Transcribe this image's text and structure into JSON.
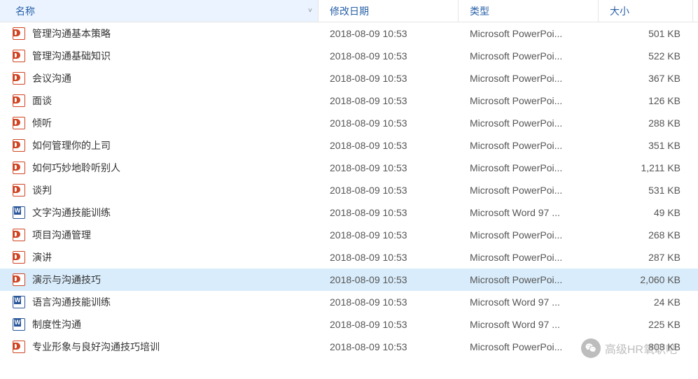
{
  "columns": {
    "name": "名称",
    "date": "修改日期",
    "type": "类型",
    "size": "大小"
  },
  "files": [
    {
      "name": "管理沟通基本策略",
      "date": "2018-08-09 10:53",
      "type": "Microsoft PowerPoi...",
      "size": "501 KB",
      "icon": "ppt",
      "selected": false
    },
    {
      "name": "管理沟通基础知识",
      "date": "2018-08-09 10:53",
      "type": "Microsoft PowerPoi...",
      "size": "522 KB",
      "icon": "ppt",
      "selected": false
    },
    {
      "name": "会议沟通",
      "date": "2018-08-09 10:53",
      "type": "Microsoft PowerPoi...",
      "size": "367 KB",
      "icon": "ppt",
      "selected": false
    },
    {
      "name": "面谈",
      "date": "2018-08-09 10:53",
      "type": "Microsoft PowerPoi...",
      "size": "126 KB",
      "icon": "ppt",
      "selected": false
    },
    {
      "name": "倾听",
      "date": "2018-08-09 10:53",
      "type": "Microsoft PowerPoi...",
      "size": "288 KB",
      "icon": "ppt",
      "selected": false
    },
    {
      "name": "如何管理你的上司",
      "date": "2018-08-09 10:53",
      "type": "Microsoft PowerPoi...",
      "size": "351 KB",
      "icon": "ppt",
      "selected": false
    },
    {
      "name": "如何巧妙地聆听别人",
      "date": "2018-08-09 10:53",
      "type": "Microsoft PowerPoi...",
      "size": "1,211 KB",
      "icon": "ppt",
      "selected": false
    },
    {
      "name": "谈判",
      "date": "2018-08-09 10:53",
      "type": "Microsoft PowerPoi...",
      "size": "531 KB",
      "icon": "ppt",
      "selected": false
    },
    {
      "name": "文字沟通技能训练",
      "date": "2018-08-09 10:53",
      "type": "Microsoft Word 97 ...",
      "size": "49 KB",
      "icon": "doc",
      "selected": false
    },
    {
      "name": "项目沟通管理",
      "date": "2018-08-09 10:53",
      "type": "Microsoft PowerPoi...",
      "size": "268 KB",
      "icon": "ppt",
      "selected": false
    },
    {
      "name": "演讲",
      "date": "2018-08-09 10:53",
      "type": "Microsoft PowerPoi...",
      "size": "287 KB",
      "icon": "ppt",
      "selected": false
    },
    {
      "name": "演示与沟通技巧",
      "date": "2018-08-09 10:53",
      "type": "Microsoft PowerPoi...",
      "size": "2,060 KB",
      "icon": "ppt",
      "selected": true
    },
    {
      "name": "语言沟通技能训练",
      "date": "2018-08-09 10:53",
      "type": "Microsoft Word 97 ...",
      "size": "24 KB",
      "icon": "doc",
      "selected": false
    },
    {
      "name": "制度性沟通",
      "date": "2018-08-09 10:53",
      "type": "Microsoft Word 97 ...",
      "size": "225 KB",
      "icon": "doc",
      "selected": false
    },
    {
      "name": "专业形象与良好沟通技巧培训",
      "date": "2018-08-09 10:53",
      "type": "Microsoft PowerPoi...",
      "size": "808 KB",
      "icon": "ppt",
      "selected": false
    }
  ],
  "watermark": {
    "text": "高级HR氧职吧"
  }
}
